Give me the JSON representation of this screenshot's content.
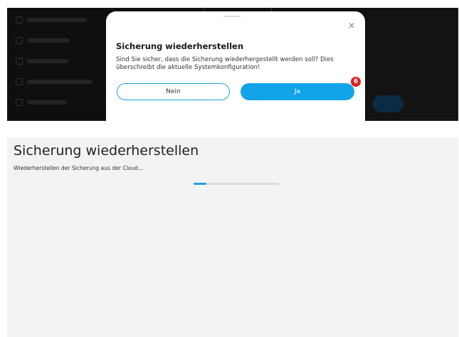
{
  "top_dialog": {
    "background_menu_items": [
      {
        "icon": "menu-item-icon"
      },
      {
        "icon": "menu-item-icon"
      },
      {
        "icon": "menu-item-icon"
      },
      {
        "icon": "menu-item-icon"
      },
      {
        "icon": "menu-item-icon"
      }
    ],
    "close_glyph": "×",
    "title": "Sicherung wiederherstellen",
    "message": "Sind Sie sicher, dass die Sicherung wiederhergestellt werden soll? Dies überschreibt die aktuelle Systemkonfiguration!",
    "cancel_label": "Nein",
    "confirm_label": "Ja",
    "step_badge": "6",
    "colors": {
      "accent": "#13a3e8",
      "badge": "#e02020"
    }
  },
  "progress_page": {
    "title": "Sicherung wiederherstellen",
    "status": "Wiederherstellen der Sicherung aus der Cloud...",
    "progress_fraction": 0.15,
    "colors": {
      "progress": "#1ea2e4",
      "background": "#f3f3f3"
    }
  }
}
